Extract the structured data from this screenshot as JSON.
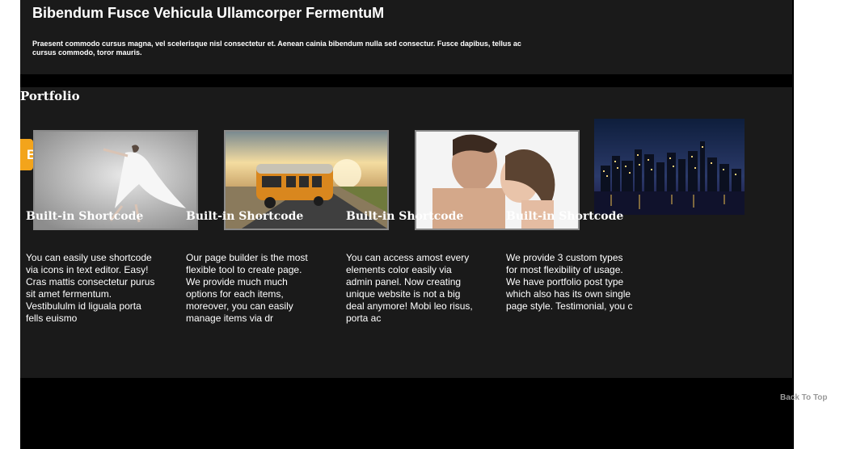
{
  "hero": {
    "title": "Bibendum Fusce Vehicula Ullamcorper FermentuM",
    "text": "Praesent commodo cursus magna, vel scelerisque nisl consectetur et. Aenean cainia bibendum nulla sed consectur. Fusce dapibus, tellus ac cursus commodo, toror mauris."
  },
  "portfolio": {
    "title": "Portfolio",
    "tab_letter": "B",
    "items": [
      {
        "icon": "dancer-photo"
      },
      {
        "icon": "bus-photo"
      },
      {
        "icon": "couple-photo"
      },
      {
        "icon": "city-skyline-photo"
      }
    ]
  },
  "features": [
    {
      "title": "Built-in Shortcode",
      "text": "You can easily use shortcode via icons in text editor. Easy! Cras mattis consectetur purus sit amet fermentum. Vestibululm id liguala porta fells euismo"
    },
    {
      "title": "Built-in Shortcode",
      "text": "Our page builder is the most flexible tool to create page. We provide much much options for each items, moreover, you can easily manage items via dr"
    },
    {
      "title": "Built-in Shortcode",
      "text": "You can access amost every elements color easily via admin panel. Now creating unique website is not a big deal anymore! Mobi leo risus, porta ac"
    },
    {
      "title": "Built-in Shortcode",
      "text": "We provide 3 custom types for most flexibility of usage. We have portfolio post type which also has its own single page style. Testimonial, you c"
    }
  ],
  "back_to_top": "Back To Top",
  "colors": {
    "accent": "#f3a41b",
    "panel": "#1a1a1a",
    "page": "#000000"
  }
}
